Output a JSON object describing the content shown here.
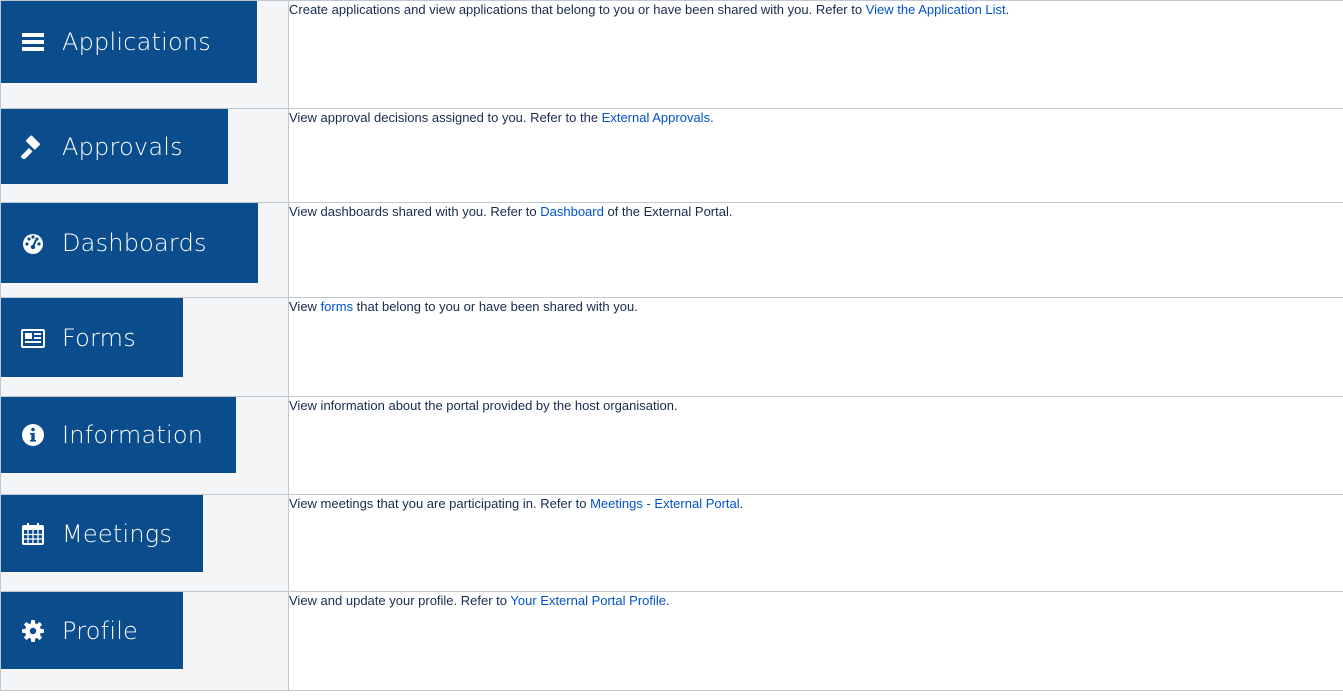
{
  "rows": [
    {
      "button_label": "Applications",
      "icon": "list-icon",
      "desc_before": "Create applications and view applications that belong to you or have been shared with you. Refer to ",
      "link_text": "View the Application List",
      "desc_after": "."
    },
    {
      "button_label": "Approvals",
      "icon": "gavel-icon",
      "desc_before": "View approval decisions assigned to you. Refer to the ",
      "link_text": "External Approvals",
      "desc_after": "."
    },
    {
      "button_label": "Dashboards",
      "icon": "dashboard-gauge-icon",
      "desc_before": "View dashboards shared with you. Refer to ",
      "link_text": "Dashboard",
      "desc_after": " of the External Portal."
    },
    {
      "button_label": "Forms",
      "icon": "form-icon",
      "desc_before": "View ",
      "link_text": "forms",
      "desc_after": " that belong to you or have been shared with you."
    },
    {
      "button_label": "Information",
      "icon": "info-circle-icon",
      "desc_before": "View information about the portal provided by the host organisation.",
      "link_text": "",
      "desc_after": ""
    },
    {
      "button_label": "Meetings",
      "icon": "calendar-icon",
      "desc_before": "View meetings that you are participating in. Refer to ",
      "link_text": "Meetings - External Portal",
      "desc_after": "."
    },
    {
      "button_label": "Profile",
      "icon": "gear-icon",
      "desc_before": "View and update your profile. Refer to ",
      "link_text": "Your External Portal Profile",
      "desc_after": "."
    }
  ],
  "colors": {
    "button_bg": "#0a4c8c",
    "link": "#0052cc",
    "border": "#c1c7d0",
    "text": "#172b4d"
  }
}
